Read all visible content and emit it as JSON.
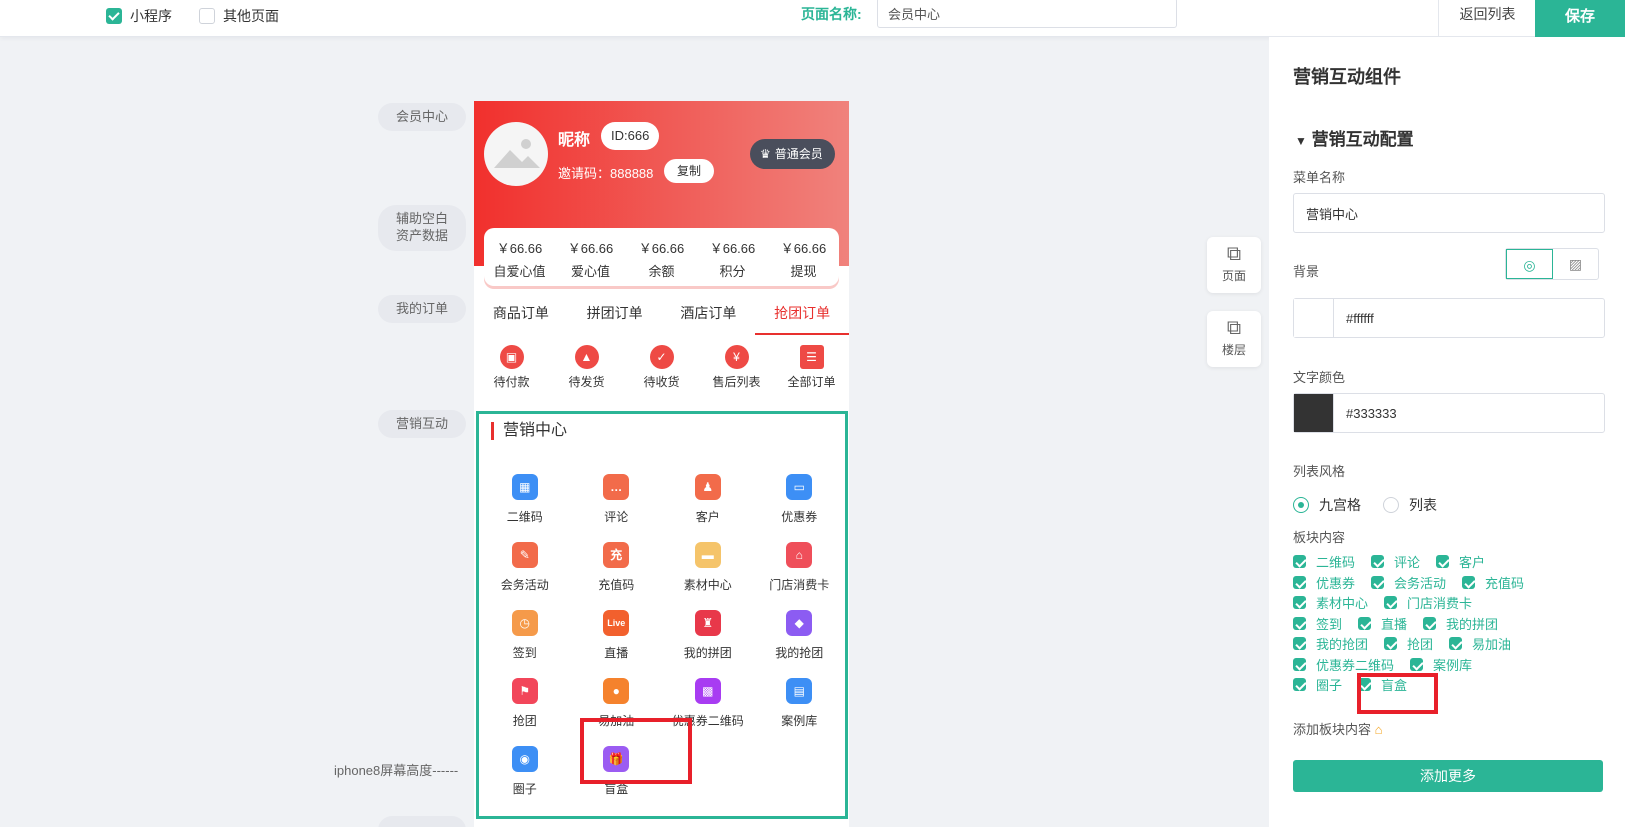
{
  "topbar": {
    "miniprogram_label": "小程序",
    "other_pages_label": "其他页面",
    "page_name_label": "页面名称:",
    "page_name_value": "会员中心",
    "back_label": "返回列表",
    "save_label": "保存"
  },
  "tags": {
    "member_center": "会员中心",
    "aux_blank": "辅助空白",
    "asset_data": "资产数据",
    "my_orders": "我的订单",
    "marketing": "营销互动",
    "iphone_guide": "iphone8屏幕高度------"
  },
  "profile": {
    "nickname": "昵称",
    "id_text": "ID:666",
    "invite_text": "邀请码：888888",
    "copy_label": "复制",
    "member_label": "普通会员"
  },
  "stats": [
    {
      "value": "￥66.66",
      "label": "自爱心值"
    },
    {
      "value": "￥66.66",
      "label": "爱心值"
    },
    {
      "value": "￥66.66",
      "label": "余额"
    },
    {
      "value": "￥66.66",
      "label": "积分"
    },
    {
      "value": "￥66.66",
      "label": "提现"
    }
  ],
  "order_tabs": [
    "商品订单",
    "拼团订单",
    "酒店订单",
    "抢团订单"
  ],
  "order_items": [
    {
      "label": "待付款",
      "icon": "truck-icon"
    },
    {
      "label": "待发货",
      "icon": "box-icon"
    },
    {
      "label": "待收货",
      "icon": "calendar-icon"
    },
    {
      "label": "售后列表",
      "icon": "refund-icon"
    },
    {
      "label": "全部订单",
      "icon": "clipboard-icon"
    }
  ],
  "marketing": {
    "title": "营销中心",
    "items": [
      {
        "label": "二维码",
        "icon": "qrcode-icon",
        "color": "#3d8ff5",
        "glyph": "▦"
      },
      {
        "label": "评论",
        "icon": "comment-icon",
        "color": "#f26b4a",
        "glyph": "…"
      },
      {
        "label": "客户",
        "icon": "customer-icon",
        "color": "#f26b4a",
        "glyph": "♟"
      },
      {
        "label": "优惠券",
        "icon": "coupon-icon",
        "color": "#3d8ff5",
        "glyph": "▭"
      },
      {
        "label": "会务活动",
        "icon": "event-icon",
        "color": "#f26b4a",
        "glyph": "✎"
      },
      {
        "label": "充值码",
        "icon": "recharge-icon",
        "color": "#f26b4a",
        "glyph": "充"
      },
      {
        "label": "素材中心",
        "icon": "folder-icon",
        "color": "#f5c46a",
        "glyph": "▬"
      },
      {
        "label": "门店消费卡",
        "icon": "store-card-icon",
        "color": "#ef4f5a",
        "glyph": "⌂"
      },
      {
        "label": "签到",
        "icon": "checkin-icon",
        "color": "#f59a4a",
        "glyph": "◷"
      },
      {
        "label": "直播",
        "icon": "live-icon",
        "color": "#f2602d",
        "glyph": "Live"
      },
      {
        "label": "我的拼团",
        "icon": "group-buy-icon",
        "color": "#e8384a",
        "glyph": "♜"
      },
      {
        "label": "我的抢团",
        "icon": "grab-group-icon",
        "color": "#8c5cf2",
        "glyph": "◆"
      },
      {
        "label": "抢团",
        "icon": "grab-icon",
        "color": "#f2465a",
        "glyph": "⚑"
      },
      {
        "label": "易加油",
        "icon": "fuel-icon",
        "color": "#f5822d",
        "glyph": "●"
      },
      {
        "label": "优惠券二维码",
        "icon": "coupon-qr-icon",
        "color": "#a83cf2",
        "glyph": "▩"
      },
      {
        "label": "案例库",
        "icon": "case-library-icon",
        "color": "#3d8ff5",
        "glyph": "▤"
      },
      {
        "label": "圈子",
        "icon": "circle-icon",
        "color": "#3d8ff5",
        "glyph": "◉"
      },
      {
        "label": "盲盒",
        "icon": "blind-box-icon",
        "color": "#9b5cf2",
        "glyph": "🎁"
      }
    ]
  },
  "side_buttons": {
    "page": "页面",
    "floor": "楼层"
  },
  "panel": {
    "title": "营销互动组件",
    "section": "营销互动配置",
    "menu_name_label": "菜单名称",
    "menu_name_value": "营销中心",
    "background_label": "背景",
    "background_color": "#ffffff",
    "text_color_label": "文字颜色",
    "text_color": "#333333",
    "list_style_label": "列表风格",
    "list_style_grid": "九宫格",
    "list_style_list": "列表",
    "block_content_label": "板块内容",
    "block_rows": [
      [
        "二维码",
        "评论",
        "客户"
      ],
      [
        "优惠券",
        "会务活动",
        "充值码"
      ],
      [
        "素材中心",
        "门店消费卡"
      ],
      [
        "签到",
        "直播",
        "我的拼团"
      ],
      [
        "我的抢团",
        "抢团",
        "易加油"
      ],
      [
        "优惠券二维码",
        "案例库"
      ],
      [
        "圈子",
        "盲盒"
      ]
    ],
    "add_block_label": "添加板块内容",
    "add_more_label": "添加更多"
  },
  "colors": {
    "accent": "#2bb596",
    "brand_red": "#e8302e",
    "highlight": "#e8202a"
  }
}
